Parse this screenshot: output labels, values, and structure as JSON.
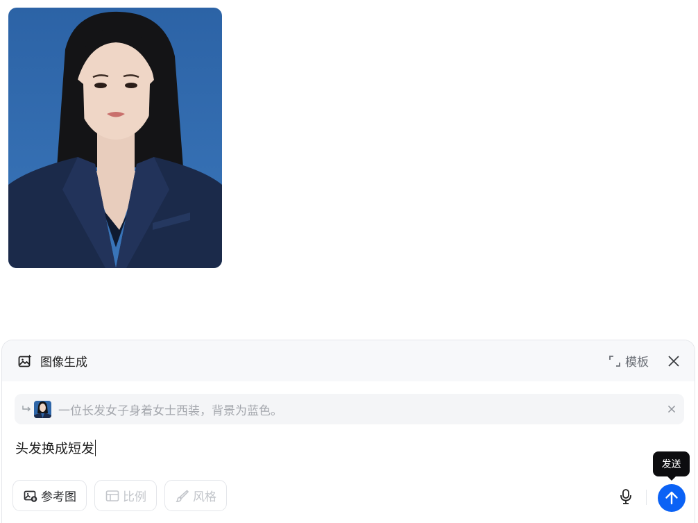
{
  "colors": {
    "accent": "#0b62f5",
    "header_bg": "#f7f8fa",
    "chip_bg": "#f4f5f7",
    "portrait_bg": "#2f66a8",
    "suit": "#1b2a4a"
  },
  "generated_image": {
    "icon": "portrait-photo"
  },
  "composer": {
    "mode_icon": "image-sparkle-icon",
    "mode_title": "图像生成",
    "template_label": "模板",
    "reference": {
      "text": "一位长发女子身着女士西装，背景为蓝色。"
    },
    "prompt_value": "头发换成短发",
    "toolbar": {
      "reference_image_label": "参考图",
      "ratio_label": "比例",
      "style_label": "风格"
    },
    "send_tooltip": "发送"
  }
}
